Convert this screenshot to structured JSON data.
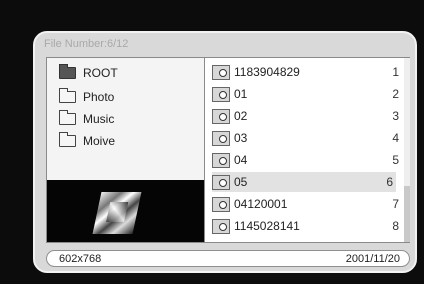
{
  "window": {
    "title": "File Number:6/12"
  },
  "sidebar": {
    "folders": [
      {
        "label": "ROOT",
        "icon": "root-folder-icon"
      },
      {
        "label": "Photo",
        "icon": "folder-icon"
      },
      {
        "label": "Music",
        "icon": "folder-icon"
      },
      {
        "label": "Moive",
        "icon": "folder-icon"
      }
    ]
  },
  "files": [
    {
      "name": "1183904829",
      "index": "1"
    },
    {
      "name": "01",
      "index": "2"
    },
    {
      "name": "02",
      "index": "3"
    },
    {
      "name": "03",
      "index": "4"
    },
    {
      "name": "04",
      "index": "5"
    },
    {
      "name": "05",
      "index": "6",
      "selected": true
    },
    {
      "name": "04120001",
      "index": "7"
    },
    {
      "name": "1145028141",
      "index": "8"
    }
  ],
  "status": {
    "resolution": "602x768",
    "date": "2001/11/20"
  }
}
